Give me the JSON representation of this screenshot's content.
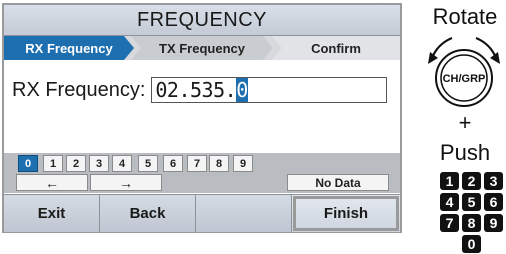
{
  "screen": {
    "title": "FREQUENCY",
    "steps": [
      "RX Frequency",
      "TX Frequency",
      "Confirm"
    ],
    "field_label": "RX Frequency:",
    "field_value_prefix": "02.535.",
    "field_value_cursor": "0",
    "keypad_digits": [
      "0",
      "1",
      "2",
      "3",
      "4",
      "5",
      "6",
      "7",
      "8",
      "9"
    ],
    "left_arrow": "←",
    "right_arrow": "→",
    "no_data_label": "No Data",
    "softkeys": [
      "Exit",
      "Back",
      "",
      "Finish"
    ]
  },
  "side": {
    "rotate_label": "Rotate",
    "knob_label": "CH/GRP",
    "plus": "+",
    "push_label": "Push",
    "digits": [
      "1",
      "2",
      "3",
      "4",
      "5",
      "6",
      "7",
      "8",
      "9",
      "0"
    ]
  },
  "colors": {
    "accent": "#1d6fb0"
  }
}
